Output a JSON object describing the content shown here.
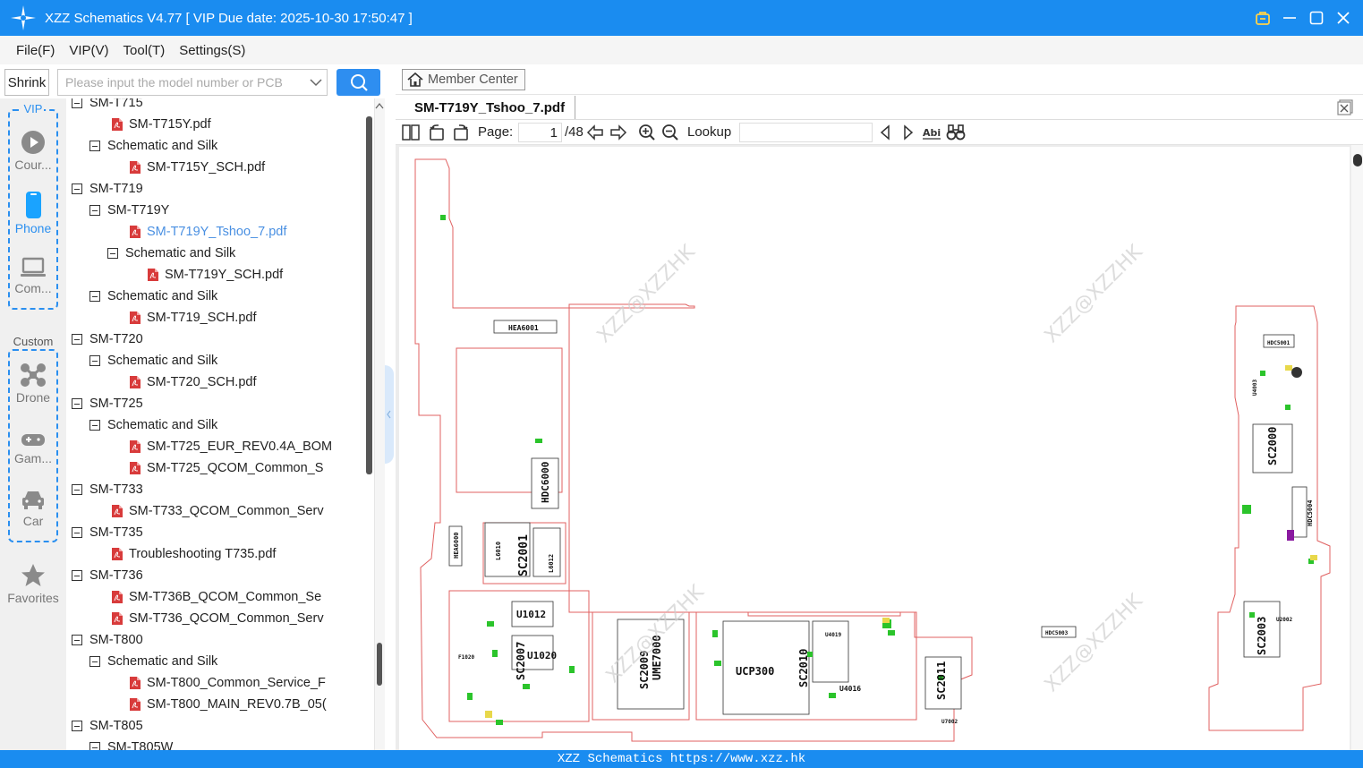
{
  "app": {
    "title": "XZZ Schematics V4.77 [ VIP Due date: 2025-10-30 17:50:47 ]",
    "accent": "#1a8cf0"
  },
  "menu": [
    "File(F)",
    "VIP(V)",
    "Tool(T)",
    "Settings(S)"
  ],
  "left_toolbar": {
    "shrink_label": "Shrink",
    "search_placeholder": "Please input the model number or PCB"
  },
  "categories": {
    "vip_label": "VIP",
    "custom_label": "Custom",
    "vip_items": [
      {
        "label": "Cour...",
        "icon": "play-circle-icon"
      },
      {
        "label": "Phone",
        "icon": "phone-icon",
        "active": true
      },
      {
        "label": "Com...",
        "icon": "laptop-icon"
      }
    ],
    "custom_items": [
      {
        "label": "Drone",
        "icon": "drone-icon"
      },
      {
        "label": "Gam...",
        "icon": "gamepad-icon"
      },
      {
        "label": "Car",
        "icon": "car-icon"
      }
    ],
    "favorites_label": "Favorites"
  },
  "tree": [
    {
      "label": "SM-T715",
      "kind": "folder",
      "level": 0
    },
    {
      "label": "SM-T715Y.pdf",
      "kind": "pdf",
      "level": 1
    },
    {
      "label": "Schematic and Silk",
      "kind": "folder",
      "level": 1
    },
    {
      "label": "SM-T715Y_SCH.pdf",
      "kind": "pdf",
      "level": 2
    },
    {
      "label": "SM-T719",
      "kind": "folder",
      "level": 0
    },
    {
      "label": "SM-T719Y",
      "kind": "folder",
      "level": 1
    },
    {
      "label": "SM-T719Y_Tshoo_7.pdf",
      "kind": "pdf",
      "level": 2,
      "selected": true
    },
    {
      "label": "Schematic and Silk",
      "kind": "folder",
      "level": 2
    },
    {
      "label": "SM-T719Y_SCH.pdf",
      "kind": "pdf",
      "level": 3
    },
    {
      "label": "Schematic and Silk",
      "kind": "folder",
      "level": 1
    },
    {
      "label": "SM-T719_SCH.pdf",
      "kind": "pdf",
      "level": 2
    },
    {
      "label": "SM-T720",
      "kind": "folder",
      "level": 0
    },
    {
      "label": "Schematic and Silk",
      "kind": "folder",
      "level": 1
    },
    {
      "label": "SM-T720_SCH.pdf",
      "kind": "pdf",
      "level": 2
    },
    {
      "label": "SM-T725",
      "kind": "folder",
      "level": 0
    },
    {
      "label": "Schematic and Silk",
      "kind": "folder",
      "level": 1
    },
    {
      "label": "SM-T725_EUR_REV0.4A_BOM",
      "kind": "pdf",
      "level": 2
    },
    {
      "label": "SM-T725_QCOM_Common_S",
      "kind": "pdf",
      "level": 2
    },
    {
      "label": "SM-T733",
      "kind": "folder",
      "level": 0
    },
    {
      "label": "SM-T733_QCOM_Common_Serv",
      "kind": "pdf",
      "level": 1
    },
    {
      "label": "SM-T735",
      "kind": "folder",
      "level": 0
    },
    {
      "label": "Troubleshooting T735.pdf",
      "kind": "pdf",
      "level": 1
    },
    {
      "label": "SM-T736",
      "kind": "folder",
      "level": 0
    },
    {
      "label": "SM-T736B_QCOM_Common_Se",
      "kind": "pdf",
      "level": 1
    },
    {
      "label": "SM-T736_QCOM_Common_Serv",
      "kind": "pdf",
      "level": 1
    },
    {
      "label": "SM-T800",
      "kind": "folder",
      "level": 0
    },
    {
      "label": "Schematic and Silk",
      "kind": "folder",
      "level": 1
    },
    {
      "label": "SM-T800_Common_Service_F",
      "kind": "pdf",
      "level": 2
    },
    {
      "label": "SM-T800_MAIN_REV0.7B_05(",
      "kind": "pdf",
      "level": 2
    },
    {
      "label": "SM-T805",
      "kind": "folder",
      "level": 0
    },
    {
      "label": "SM-T805W",
      "kind": "folder",
      "level": 1
    }
  ],
  "document": {
    "member_center_label": "Member Center",
    "tab_label": "SM-T719Y_Tshoo_7.pdf",
    "page_label": "Page:",
    "current_page": "1",
    "total_pages": "/48",
    "lookup_label": "Lookup",
    "lookup_value": "",
    "watermark": "XZZ@XZZHK",
    "components": [
      "HEA6001",
      "HDC6000",
      "HEA6000",
      "SC2001",
      "L6010",
      "L6012",
      "U1012",
      "SC2007",
      "U1020",
      "F1020",
      "SC2009",
      "UME7000",
      "UCP300",
      "SC2010",
      "U4019",
      "U4016",
      "SC2011",
      "U7002",
      "HDC5003",
      "HDC5001",
      "SC2000",
      "HDC5004",
      "SC2003",
      "U2002",
      "U4003"
    ]
  },
  "status_bar": "XZZ Schematics https://www.xzz.hk"
}
